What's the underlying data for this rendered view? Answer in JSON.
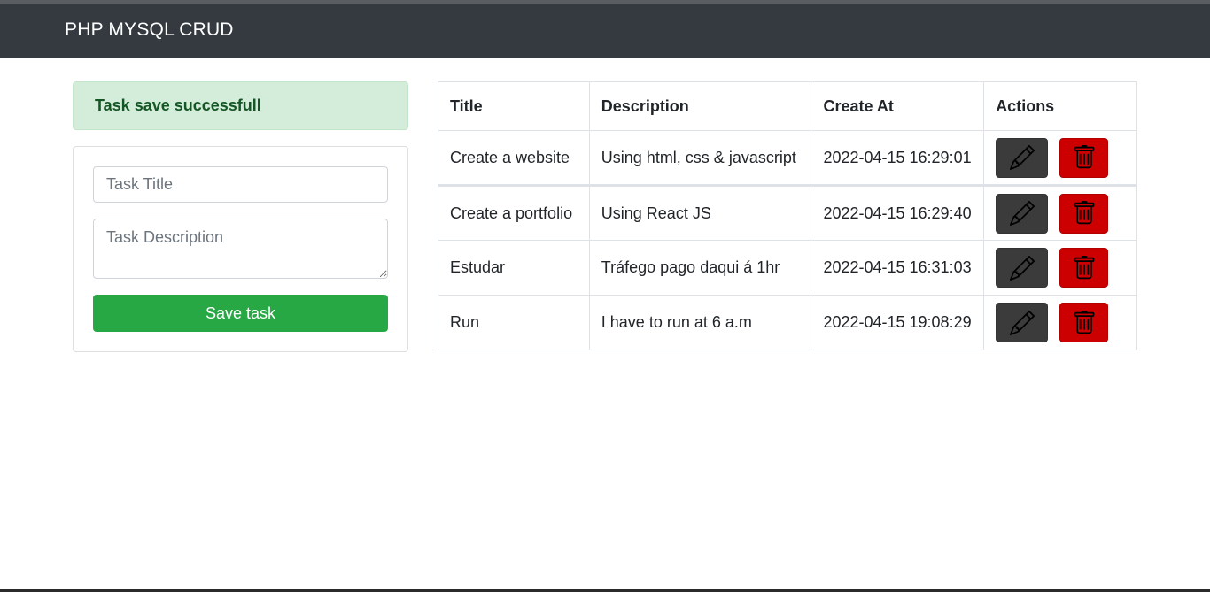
{
  "navbar": {
    "brand": "PHP MYSQL CRUD"
  },
  "alert": {
    "message": "Task save successfull",
    "color": "#d4edda"
  },
  "form": {
    "title_placeholder": "Task Title",
    "title_value": "",
    "description_placeholder": "Task Description",
    "description_value": "",
    "save_label": "Save task",
    "save_color": "#28a745"
  },
  "table": {
    "headers": [
      "Title",
      "Description",
      "Create At",
      "Actions"
    ],
    "rows": [
      {
        "title": "Create a website",
        "description": "Using html, css & javascript",
        "created_at": "2022-04-15 16:29:01"
      },
      {
        "title": "Create a portfolio",
        "description": "Using React JS",
        "created_at": "2022-04-15 16:29:40"
      },
      {
        "title": "Estudar",
        "description": "Tráfego pago daqui á 1hr",
        "created_at": "2022-04-15 16:31:03"
      },
      {
        "title": "Run",
        "description": "I have to run at 6 a.m",
        "created_at": "2022-04-15 19:08:29"
      }
    ],
    "actions": [
      {
        "name": "edit",
        "icon": "pencil-icon",
        "color": "#3b3b3b"
      },
      {
        "name": "delete",
        "icon": "trash-icon",
        "color": "#cc0000"
      }
    ]
  }
}
